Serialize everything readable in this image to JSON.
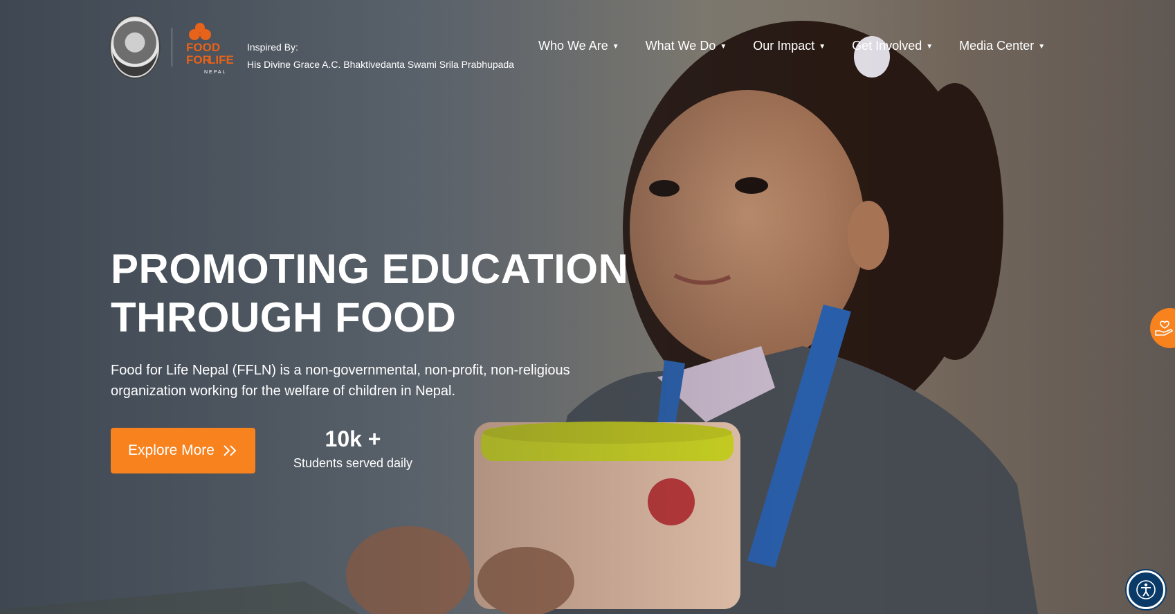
{
  "header": {
    "logo_text": "FOOD FOR LIFE NEPAL",
    "inspired_label": "Inspired By:",
    "inspired_name": "His Divine Grace A.C. Bhaktivedanta Swami Srila Prabhupada"
  },
  "nav": {
    "items": [
      {
        "label": "Who We Are"
      },
      {
        "label": "What We Do"
      },
      {
        "label": "Our Impact"
      },
      {
        "label": "Get Involved"
      },
      {
        "label": "Media Center"
      }
    ]
  },
  "hero": {
    "headline_line1": "PROMOTING EDUCATION",
    "headline_line2": "THROUGH FOOD",
    "description": "Food for Life Nepal (FFLN) is a non-governmental, non-profit, non-religious organization working for the welfare of children in Nepal.",
    "cta_label": "Explore More",
    "stat_value": "10k +",
    "stat_label": "Students served daily"
  },
  "icons": {
    "cta": "double-chevron-right-icon",
    "donate": "hand-heart-icon",
    "accessibility": "accessibility-icon"
  },
  "colors": {
    "accent": "#f7821e",
    "accessibility_button": "#0a3a68"
  }
}
